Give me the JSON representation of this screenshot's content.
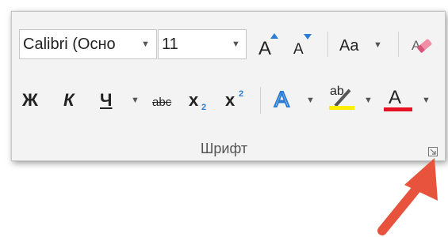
{
  "font_group": {
    "group_label": "Шрифт",
    "font_name_value": "Calibri (Осно",
    "font_size_value": "11",
    "grow_font_letter": "A",
    "shrink_font_letter": "A",
    "change_case_label": "Aa",
    "bold_label": "Ж",
    "italic_label": "К",
    "underline_label": "Ч",
    "strikethrough_label": "abc",
    "subscript_label": "x",
    "subscript_sub": "2",
    "superscript_label": "x",
    "superscript_sup": "2",
    "text_effects_letter": "A",
    "highlight_letters": "ab",
    "font_color_letter": "A"
  },
  "colors": {
    "highlight_bar": "#ffee00",
    "font_color_bar": "#e81123",
    "accent_blue": "#2b7cd3",
    "arrow": "#e8533d"
  },
  "icons": [
    "dropdown-arrow-icon",
    "grow-font-icon",
    "shrink-font-icon",
    "clear-formatting-icon",
    "text-effects-icon",
    "highlight-icon",
    "font-color-icon",
    "dialog-launcher-icon",
    "pointer-arrow-icon"
  ]
}
